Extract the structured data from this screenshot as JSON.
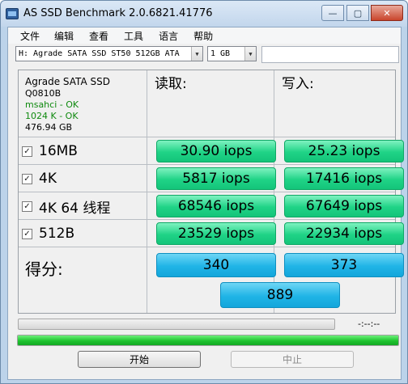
{
  "window": {
    "title": "AS SSD Benchmark 2.0.6821.41776",
    "controls": {
      "minimize": "—",
      "maximize": "▢",
      "close": "✕"
    }
  },
  "menu": [
    "文件",
    "编辑",
    "查看",
    "工具",
    "语言",
    "帮助"
  ],
  "toolbar": {
    "drive_value": "H: Agrade SATA SSD ST50 512GB ATA",
    "size_value": "1 GB",
    "extra_field_value": ""
  },
  "drive_info": {
    "model": "Agrade SATA SSD",
    "firmware": "Q0810B",
    "driver_status": "msahci - OK",
    "alignment_status": "1024 K - OK",
    "capacity": "476.94 GB"
  },
  "columns": {
    "read": "读取:",
    "write": "写入:"
  },
  "rows": [
    {
      "label": "16MB",
      "checked": true,
      "read": "30.90 iops",
      "write": "25.23 iops"
    },
    {
      "label": "4K",
      "checked": true,
      "read": "5817 iops",
      "write": "17416 iops"
    },
    {
      "label": "4K 64 线程",
      "checked": true,
      "read": "68546 iops",
      "write": "67649 iops"
    },
    {
      "label": "512B",
      "checked": true,
      "read": "23529 iops",
      "write": "22934 iops"
    }
  ],
  "score": {
    "label": "得分:",
    "read": "340",
    "write": "373",
    "total": "889"
  },
  "progress": {
    "time_text": "-:--:--",
    "task_progress": 0.0,
    "overall_progress": 1.0
  },
  "buttons": {
    "start": "开始",
    "abort": "中止"
  },
  "colors": {
    "result_pill": "#1fd386",
    "score_pill": "#20b4e6",
    "progress_fill": "#1fc42f",
    "ok_text": "#0f8a0f"
  }
}
